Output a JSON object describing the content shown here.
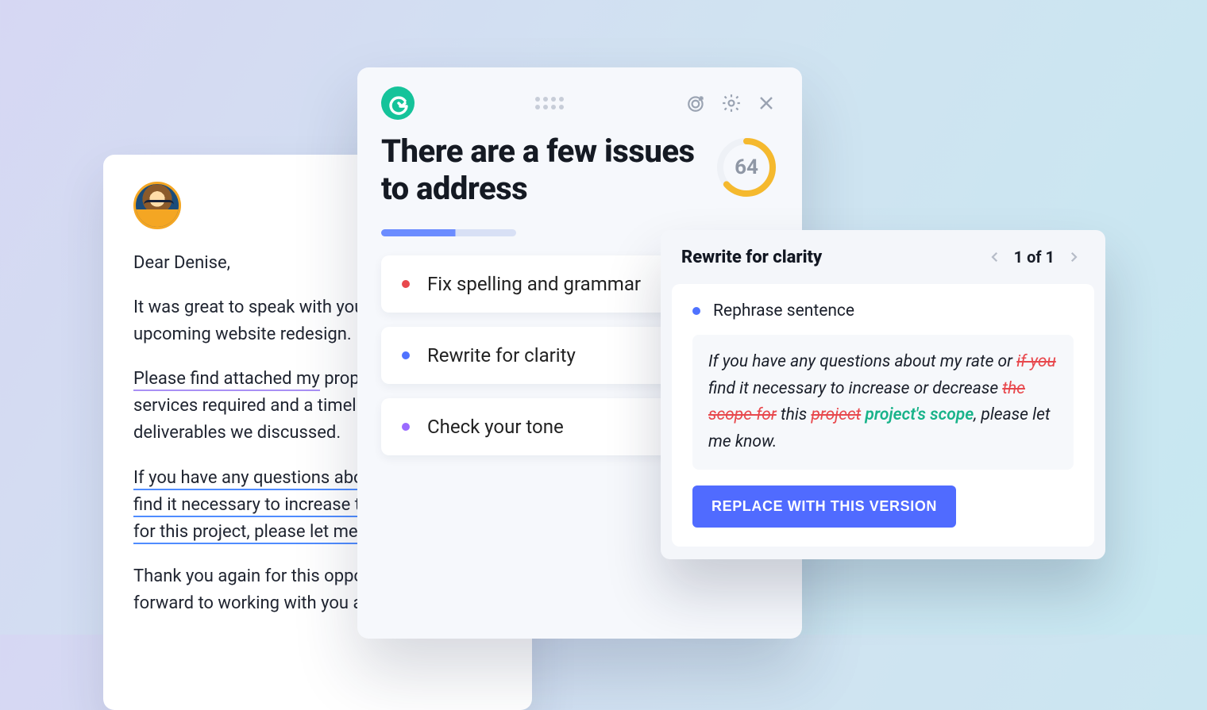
{
  "email": {
    "greeting": "Dear Denise,",
    "p1": "It was great to speak with you about your upcoming website redesign.",
    "p2_pre": "Please find attached my",
    "p2_rest": " proposal for the services required and a timeline for the deliverables we discussed.",
    "p3_l1": "If you have any questions about my rate or",
    "p3_l2": "find it necessary to increase the scope",
    "p3_l3": "for this project, please let me know.",
    "p4": "Thank you again for this opportunity. I look forward to working with you and your team."
  },
  "assistant": {
    "title": "There are a few issues to address",
    "score": "64",
    "suggestions": [
      {
        "color": "red",
        "label": "Fix spelling and grammar"
      },
      {
        "color": "blue",
        "label": "Rewrite for clarity"
      },
      {
        "color": "purple",
        "label": "Check your tone"
      }
    ]
  },
  "rewrite": {
    "heading": "Rewrite for clarity",
    "page": "1 of 1",
    "subheading": "Rephrase sentence",
    "diff": {
      "t1": "If you have any questions about my rate or ",
      "del1": "if you",
      "t2": " find it necessary to increase or decrease ",
      "del2": "the scope for",
      "t3": " this ",
      "del3": "project",
      "ins1": "project's scope",
      "t4": ", please let me know."
    },
    "button": "REPLACE WITH THIS VERSION"
  }
}
